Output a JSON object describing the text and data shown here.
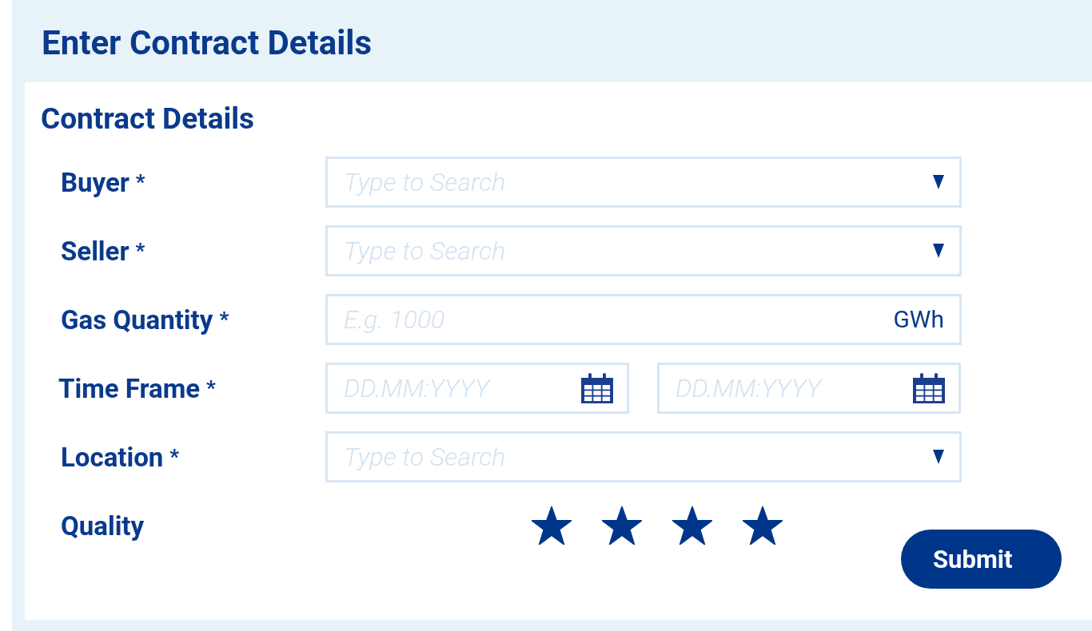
{
  "header": {
    "title": "Enter Contract Details"
  },
  "section": {
    "title": "Contract Details"
  },
  "fields": [
    {
      "kind": "dropdown",
      "label": "Buyer",
      "required_mark": "*",
      "placeholder": "Type to Search"
    },
    {
      "kind": "dropdown",
      "label": "Seller",
      "required_mark": "*",
      "placeholder": "Type to Search"
    },
    {
      "kind": "unit",
      "label": "Gas Quantity",
      "required_mark": "*",
      "placeholder": "E.g. 1000",
      "unit": "GWh"
    },
    {
      "kind": "daterange",
      "label": "Time Frame",
      "required_mark": "*",
      "placeholders": [
        "DD.MM:YYYY",
        "DD.MM:YYYY"
      ]
    },
    {
      "kind": "dropdown",
      "label": "Location",
      "required_mark": "*",
      "placeholder": "Type to Search"
    }
  ],
  "quality": {
    "label": "Quality",
    "stars": 4
  },
  "submit": {
    "label": "Submit"
  }
}
